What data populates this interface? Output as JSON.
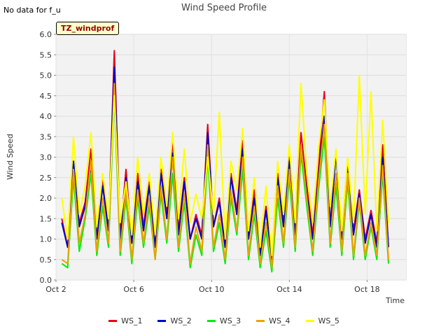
{
  "header": {
    "note": "No data for f_u",
    "badge": "TZ_windprof"
  },
  "chart_data": {
    "type": "line",
    "title": "Wind Speed Profile",
    "xlabel": "Time",
    "ylabel": "Wind Speed",
    "ylim": [
      0,
      6
    ],
    "y_ticks": [
      "0.0",
      "0.5",
      "1.0",
      "1.5",
      "2.0",
      "2.5",
      "3.0",
      "3.5",
      "4.0",
      "4.5",
      "5.0",
      "5.5",
      "6.0"
    ],
    "x_ticks": [
      {
        "label": "Oct 2",
        "day": 2
      },
      {
        "label": "Oct 6",
        "day": 6
      },
      {
        "label": "Oct 10",
        "day": 10
      },
      {
        "label": "Oct 14",
        "day": 14
      },
      {
        "label": "Oct 18",
        "day": 18
      }
    ],
    "xlim_days": [
      2,
      20
    ],
    "grid": true,
    "legend_position": "bottom",
    "x_days": [
      2.3,
      2.6,
      2.9,
      3.2,
      3.5,
      3.8,
      4.1,
      4.4,
      4.7,
      5.0,
      5.3,
      5.6,
      5.9,
      6.2,
      6.5,
      6.8,
      7.1,
      7.4,
      7.7,
      8.0,
      8.3,
      8.6,
      8.9,
      9.2,
      9.5,
      9.8,
      10.1,
      10.4,
      10.7,
      11.0,
      11.3,
      11.6,
      11.9,
      12.2,
      12.5,
      12.8,
      13.1,
      13.4,
      13.7,
      14.0,
      14.3,
      14.6,
      14.9,
      15.2,
      15.5,
      15.8,
      16.1,
      16.4,
      16.7,
      17.0,
      17.3,
      17.6,
      17.9,
      18.2,
      18.5,
      18.8,
      19.1
    ],
    "series": [
      {
        "name": "WS_1",
        "color": "#e8001c",
        "values": [
          1.5,
          0.8,
          2.6,
          1.4,
          1.9,
          3.2,
          1.0,
          2.5,
          1.2,
          5.6,
          1.1,
          2.7,
          0.9,
          2.6,
          1.3,
          2.4,
          0.8,
          2.7,
          1.6,
          3.4,
          1.2,
          2.5,
          1.0,
          1.6,
          1.1,
          3.8,
          1.3,
          2.0,
          0.8,
          2.6,
          1.7,
          3.4,
          1.0,
          2.2,
          0.6,
          1.8,
          0.5,
          2.6,
          1.4,
          3.0,
          1.2,
          3.6,
          2.3,
          1.1,
          2.7,
          4.6,
          1.4,
          2.5,
          1.0,
          2.9,
          1.2,
          2.2,
          1.0,
          1.7,
          0.9,
          3.3,
          0.8
        ]
      },
      {
        "name": "WS_2",
        "color": "#0000cc",
        "values": [
          1.4,
          0.8,
          2.9,
          1.3,
          1.8,
          2.8,
          1.0,
          2.3,
          1.2,
          5.2,
          1.0,
          2.5,
          0.9,
          2.4,
          1.2,
          2.3,
          0.8,
          2.6,
          1.5,
          3.1,
          1.1,
          2.4,
          1.0,
          1.5,
          1.0,
          3.6,
          1.3,
          1.9,
          0.8,
          2.5,
          1.6,
          3.2,
          1.0,
          2.0,
          0.6,
          1.7,
          0.5,
          2.5,
          1.3,
          2.9,
          1.1,
          3.3,
          2.1,
          1.0,
          2.5,
          4.0,
          1.3,
          3.1,
          1.0,
          2.8,
          1.1,
          2.1,
          0.9,
          1.6,
          0.8,
          3.0,
          0.8
        ]
      },
      {
        "name": "WS_3",
        "color": "#00ee00",
        "values": [
          0.4,
          0.3,
          2.5,
          0.7,
          1.5,
          2.6,
          0.6,
          1.8,
          0.8,
          4.5,
          0.6,
          2.0,
          0.4,
          2.0,
          0.8,
          1.8,
          0.5,
          2.1,
          0.9,
          2.6,
          0.7,
          1.9,
          0.3,
          1.1,
          0.6,
          3.0,
          0.7,
          1.4,
          0.4,
          2.0,
          1.1,
          2.7,
          0.5,
          1.6,
          0.3,
          1.2,
          0.2,
          2.0,
          0.8,
          2.5,
          0.7,
          3.1,
          1.8,
          0.6,
          2.2,
          3.5,
          0.8,
          2.3,
          0.6,
          2.4,
          0.5,
          1.9,
          0.5,
          1.3,
          0.5,
          2.6,
          0.4
        ]
      },
      {
        "name": "WS_4",
        "color": "#f0a000",
        "values": [
          0.5,
          0.4,
          2.7,
          0.9,
          1.6,
          2.9,
          0.7,
          2.0,
          0.9,
          4.8,
          0.7,
          2.2,
          0.5,
          2.2,
          0.9,
          2.0,
          0.5,
          2.3,
          1.0,
          3.0,
          0.8,
          2.1,
          0.4,
          1.3,
          0.7,
          3.3,
          0.8,
          1.6,
          0.5,
          2.2,
          1.2,
          3.0,
          0.6,
          1.8,
          0.4,
          1.4,
          0.3,
          2.3,
          0.9,
          2.7,
          0.8,
          3.3,
          2.0,
          0.7,
          2.4,
          3.8,
          0.9,
          2.6,
          0.7,
          2.6,
          0.6,
          2.0,
          0.6,
          1.4,
          0.6,
          2.8,
          0.5
        ]
      },
      {
        "name": "WS_5",
        "color": "#ffff00",
        "values": [
          2.0,
          1.0,
          3.5,
          1.6,
          2.3,
          3.6,
          1.3,
          2.6,
          1.5,
          4.5,
          1.4,
          2.4,
          1.1,
          3.0,
          1.6,
          2.6,
          1.1,
          3.0,
          1.8,
          3.6,
          1.5,
          3.2,
          1.4,
          2.1,
          1.5,
          3.0,
          1.6,
          4.1,
          1.0,
          2.9,
          2.2,
          3.7,
          1.2,
          2.5,
          0.8,
          2.3,
          0.6,
          2.9,
          1.6,
          3.3,
          1.4,
          4.8,
          2.6,
          1.4,
          3.2,
          4.4,
          1.8,
          3.2,
          1.2,
          3.0,
          1.4,
          5.0,
          1.6,
          4.6,
          1.2,
          3.9,
          1.4
        ]
      }
    ]
  }
}
